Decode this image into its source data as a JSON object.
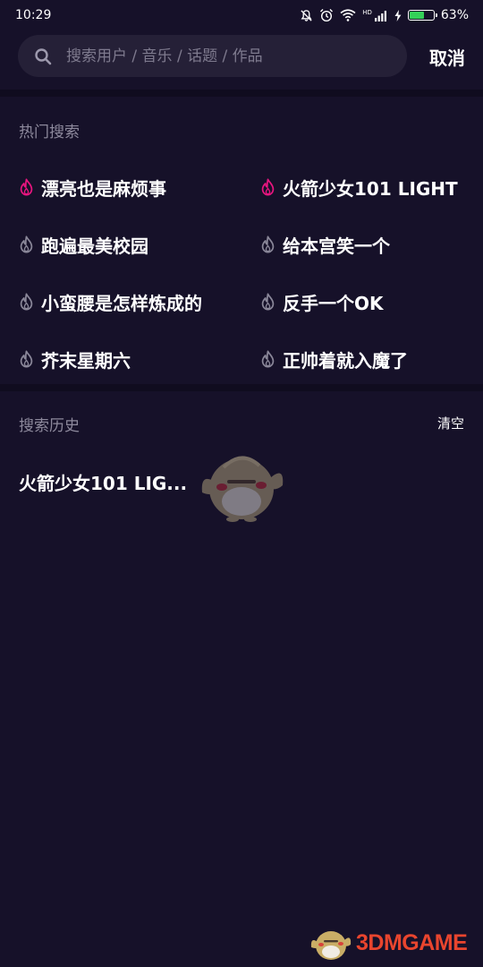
{
  "status_bar": {
    "time": "10:29",
    "network_label": "HD",
    "battery_percent_text": "63%",
    "battery_level": 0.63,
    "battery_color": "#34d058"
  },
  "search": {
    "placeholder": "搜索用户 / 音乐 / 话题 / 作品",
    "value": "",
    "cancel_label": "取消"
  },
  "hot_search": {
    "title": "热门搜索",
    "items": [
      {
        "label": "漂亮也是麻烦事",
        "icon": "flame-icon",
        "highlighted": true
      },
      {
        "label": "火箭少女101 LIGHT",
        "icon": "flame-icon",
        "highlighted": true
      },
      {
        "label": "跑遍最美校园",
        "icon": "flame-icon",
        "highlighted": false
      },
      {
        "label": "给本宫笑一个",
        "icon": "flame-icon",
        "highlighted": false
      },
      {
        "label": "小蛮腰是怎样炼成的",
        "icon": "flame-icon",
        "highlighted": false
      },
      {
        "label": "反手一个OK",
        "icon": "flame-icon",
        "highlighted": false
      },
      {
        "label": "芥末星期六",
        "icon": "flame-icon",
        "highlighted": false
      },
      {
        "label": "正帅着就入魔了",
        "icon": "flame-icon",
        "highlighted": false
      }
    ]
  },
  "history": {
    "title": "搜索历史",
    "clear_label": "清空",
    "items": [
      {
        "label": "火箭少女101 LIG..."
      }
    ]
  },
  "watermark": {
    "text": "3DMGAME",
    "icon": "mascot-logo-icon"
  },
  "colors": {
    "background": "#161129",
    "hot_accent": "#e8157f",
    "inactive_icon": "#8a8799",
    "watermark": "#e9452e"
  }
}
